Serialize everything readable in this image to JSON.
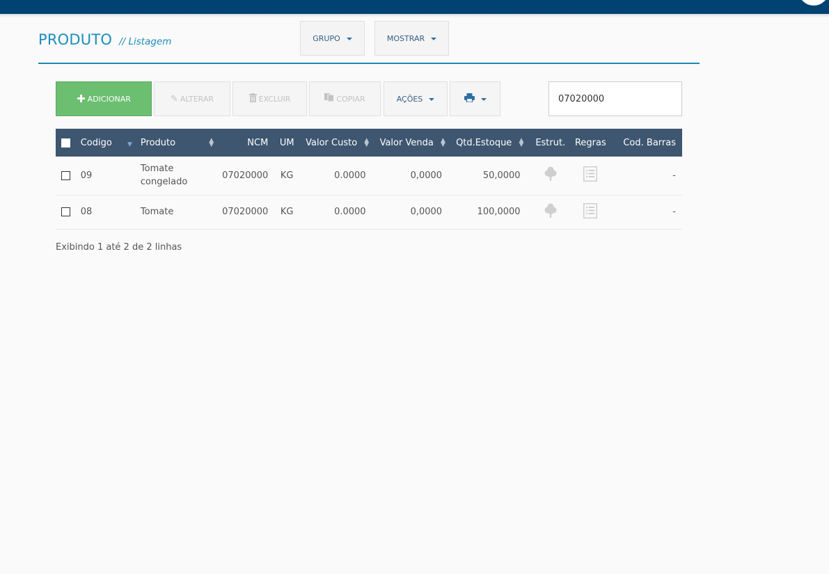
{
  "header": {
    "title": "PRODUTO",
    "subtitle": "// Listagem",
    "grupo_label": "GRUPO",
    "mostrar_label": "MOSTRAR"
  },
  "toolbar": {
    "adicionar": "ADICIONAR",
    "alterar": "ALTERAR",
    "excluir": "EXCLUIR",
    "copiar": "COPIAR",
    "acoes": "AÇÕES",
    "search_value": "07020000"
  },
  "table": {
    "columns": {
      "codigo": "Codigo",
      "produto": "Produto",
      "ncm": "NCM",
      "um": "UM",
      "valor_custo": "Valor Custo",
      "valor_venda": "Valor Venda",
      "qtd_estoque": "Qtd.Estoque",
      "estrut": "Estrut.",
      "regras": "Regras",
      "cod_barras": "Cod. Barras"
    },
    "rows": [
      {
        "codigo": "09",
        "produto": "Tomate congelado",
        "ncm": "07020000",
        "um": "KG",
        "valor_custo": "0.0000",
        "valor_venda": "0,0000",
        "qtd_estoque": "50,0000",
        "cod_barras": "-"
      },
      {
        "codigo": "08",
        "produto": "Tomate",
        "ncm": "07020000",
        "um": "KG",
        "valor_custo": "0.0000",
        "valor_venda": "0,0000",
        "qtd_estoque": "100,0000",
        "cod_barras": "-"
      }
    ]
  },
  "footer": {
    "info": "Exibindo 1 até 2 de 2 linhas"
  },
  "colors": {
    "topbar": "#004372",
    "accent": "#1d8db9",
    "table_header": "#3e566f",
    "add_button": "#6cbe70"
  }
}
